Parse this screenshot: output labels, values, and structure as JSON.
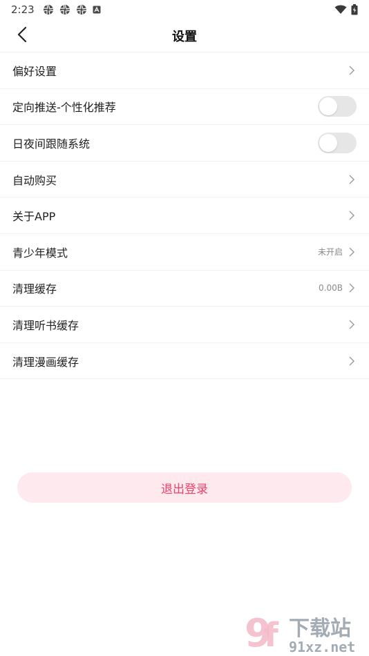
{
  "status_bar": {
    "time": "2:23",
    "notification_icons": [
      "aperture-icon",
      "aperture-icon",
      "aperture-icon",
      "a-box-icon"
    ],
    "wifi_icon": "wifi-icon",
    "battery_icon": "battery-icon"
  },
  "header": {
    "title": "设置",
    "back_icon": "back-chevron-icon"
  },
  "settings": [
    {
      "label": "偏好设置",
      "type": "link",
      "value": ""
    },
    {
      "label": "定向推送-个性化推荐",
      "type": "toggle",
      "on": false
    },
    {
      "label": "日夜间跟随系统",
      "type": "toggle",
      "on": false
    },
    {
      "label": "自动购买",
      "type": "link",
      "value": ""
    },
    {
      "label": "关于APP",
      "type": "link",
      "value": ""
    },
    {
      "label": "青少年模式",
      "type": "link",
      "value": "未开启"
    },
    {
      "label": "清理缓存",
      "type": "link",
      "value": "0.00B"
    },
    {
      "label": "清理听书缓存",
      "type": "link",
      "value": ""
    },
    {
      "label": "清理漫画缓存",
      "type": "link",
      "value": ""
    }
  ],
  "logout": {
    "label": "退出登录"
  },
  "watermark": {
    "brand_text": "下载站",
    "domain_text": "91xz.net"
  },
  "colors": {
    "accent": "#f0406b",
    "logout_bg": "#fde9ee",
    "toggle_off": "#e6e6e6"
  }
}
